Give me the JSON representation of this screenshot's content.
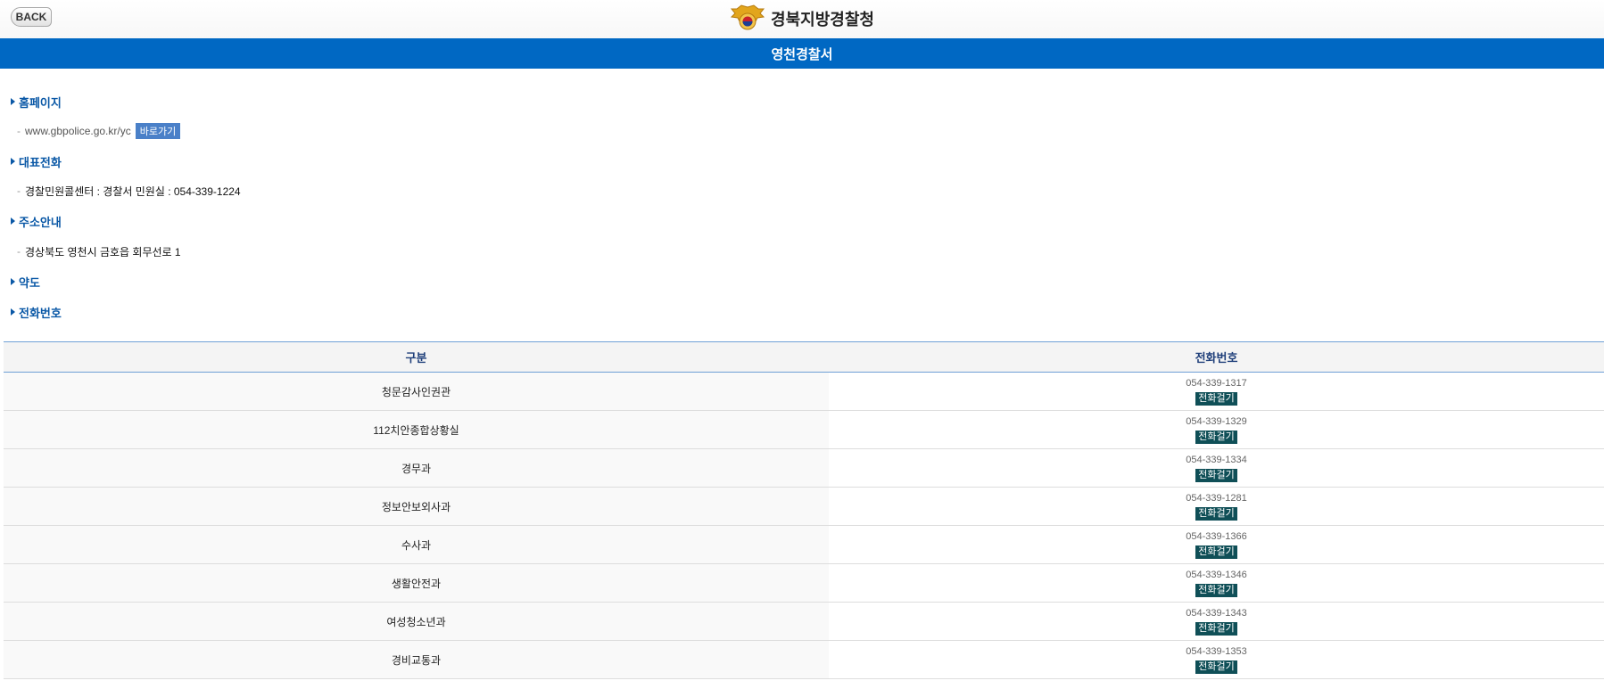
{
  "header": {
    "back_label": "BACK",
    "agency": "경북지방경찰청"
  },
  "station": {
    "title": "영천경찰서"
  },
  "sections": {
    "homepage": {
      "title": "홈페이지",
      "url": "www.gbpolice.go.kr/yc",
      "go_label": "바로가기"
    },
    "main_phone": {
      "title": "대표전화",
      "text": "경찰민원콜센터 : 경찰서 민원실 : 054-339-1224"
    },
    "address": {
      "title": "주소안내",
      "text": "경상북도 영천시 금호읍 회무선로 1"
    },
    "map": {
      "title": "약도"
    },
    "phones": {
      "title": "전화번호"
    }
  },
  "dash": "-",
  "table": {
    "headers": [
      "구분",
      "전화번호"
    ],
    "call_label": "전화걸기",
    "rows": [
      {
        "dept": "청문감사인권관",
        "phone": "054-339-1317"
      },
      {
        "dept": "112치안종합상황실",
        "phone": "054-339-1329"
      },
      {
        "dept": "경무과",
        "phone": "054-339-1334"
      },
      {
        "dept": "정보안보외사과",
        "phone": "054-339-1281"
      },
      {
        "dept": "수사과",
        "phone": "054-339-1366"
      },
      {
        "dept": "생활안전과",
        "phone": "054-339-1346"
      },
      {
        "dept": "여성청소년과",
        "phone": "054-339-1343"
      },
      {
        "dept": "경비교통과",
        "phone": "054-339-1353"
      }
    ]
  },
  "colors": {
    "brand_blue": "#0068c3",
    "section_title": "#0a58a6",
    "call_button": "#0f4f57",
    "go_button": "#4a80c8"
  }
}
